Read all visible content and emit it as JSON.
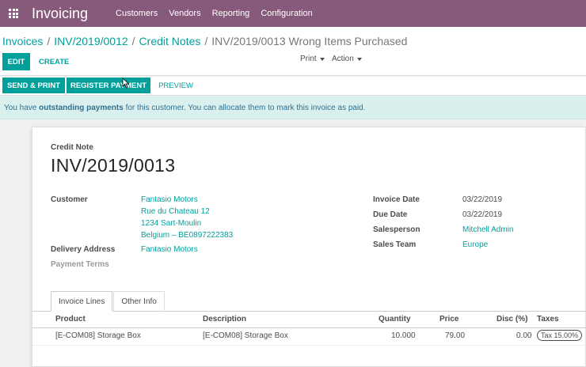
{
  "app": {
    "brand": "Invoicing",
    "menu": [
      "Customers",
      "Vendors",
      "Reporting",
      "Configuration"
    ]
  },
  "breadcrumb": {
    "items": [
      "Invoices",
      "INV/2019/0012",
      "Credit Notes"
    ],
    "current": "INV/2019/0013 Wrong Items Purchased",
    "separator": "/"
  },
  "toolbar": {
    "edit": "EDIT",
    "create": "CREATE",
    "print": "Print",
    "action": "Action"
  },
  "statusbar": {
    "send_print": "SEND & PRINT",
    "register_payment": "REGISTER PAYMENT",
    "preview": "PREVIEW"
  },
  "alert": {
    "prefix": "You have ",
    "bold": "outstanding payments",
    "suffix": " for this customer. You can allocate them to mark this invoice as paid."
  },
  "document": {
    "type": "Credit Note",
    "name": "INV/2019/0013"
  },
  "fields": {
    "customer_label": "Customer",
    "customer_lines": [
      "Fantasio Motors",
      "Rue du Chateau 12",
      "1234 Sart-Moulin",
      "Belgium – BE0897222383"
    ],
    "delivery_label": "Delivery Address",
    "delivery_value": "Fantasio Motors",
    "payment_terms_label": "Payment Terms",
    "invoice_date_label": "Invoice Date",
    "invoice_date": "03/22/2019",
    "due_date_label": "Due Date",
    "due_date": "03/22/2019",
    "salesperson_label": "Salesperson",
    "salesperson": "Mitchell Admin",
    "sales_team_label": "Sales Team",
    "sales_team": "Europe"
  },
  "tabs": [
    "Invoice Lines",
    "Other Info"
  ],
  "lines": {
    "headers": {
      "product": "Product",
      "description": "Description",
      "quantity": "Quantity",
      "price": "Price",
      "disc": "Disc (%)",
      "taxes": "Taxes"
    },
    "rows": [
      {
        "product": "[E-COM08] Storage Box",
        "description": "[E-COM08] Storage Box",
        "quantity": "10.000",
        "price": "79.00",
        "disc": "0.00",
        "taxes": "Tax 15.00%"
      }
    ]
  },
  "colors": {
    "navbar": "#875a7b",
    "accent": "#00a09d",
    "alert_bg": "#d9f0ee"
  }
}
